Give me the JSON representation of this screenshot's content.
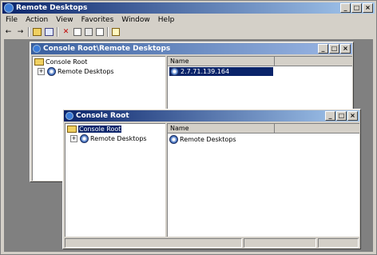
{
  "app": {
    "title": "Remote Desktops",
    "menu": [
      "File",
      "Action",
      "View",
      "Favorites",
      "Window",
      "Help"
    ],
    "title_buttons": [
      "_",
      "□",
      "×"
    ]
  },
  "window_back": {
    "title": "Console Root\\Remote Desktops",
    "tree": [
      {
        "label": "Console Root"
      },
      {
        "label": "Remote Desktops",
        "expander": "+"
      }
    ],
    "list_header": "Name",
    "list_items": [
      {
        "label": "2.7.71.139.164"
      }
    ]
  },
  "window_front": {
    "title": "Console Root",
    "tree": [
      {
        "label": "Console Root"
      },
      {
        "label": "Remote Desktops",
        "expander": "+"
      }
    ],
    "list_header": "Name",
    "list_items": [
      {
        "label": "Remote Desktops"
      }
    ]
  },
  "colors": {
    "title_active": "#0a246a",
    "face": "#d4d0c8",
    "workspace": "#808080"
  }
}
